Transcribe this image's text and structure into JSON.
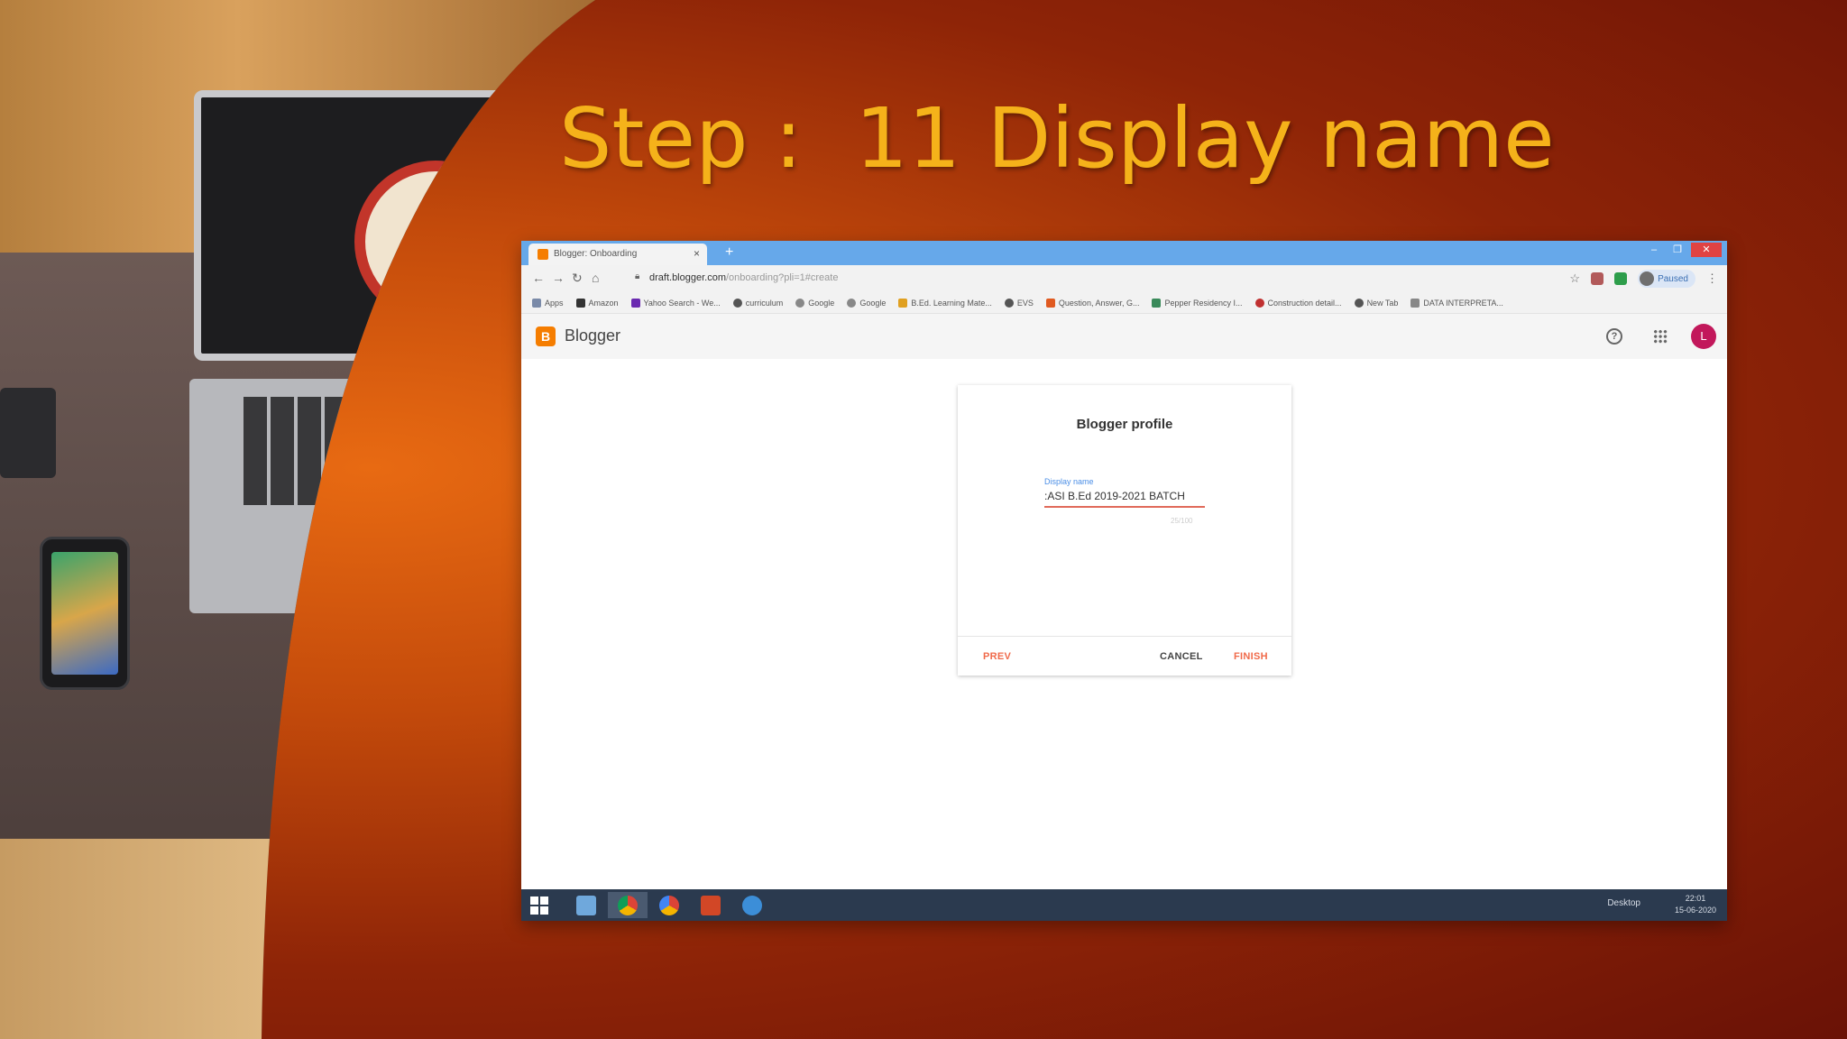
{
  "slide": {
    "title": "Step :  11 Display name"
  },
  "browser": {
    "tab_title": "Blogger: Onboarding",
    "tab_close": "×",
    "new_tab": "+",
    "window_buttons": [
      "–",
      "❐",
      "✕"
    ],
    "url_host": "draft.blogger.com",
    "url_path": "/onboarding?pli=1#create",
    "profile_label": "Paused",
    "bookmarks": [
      "Apps",
      "Amazon",
      "Yahoo Search - We...",
      "curriculum",
      "Google",
      "Google",
      "B.Ed. Learning Mate...",
      "EVS",
      "Question, Answer, G...",
      "Pepper Residency I...",
      "Construction detail...",
      "New Tab",
      "DATA INTERPRETA..."
    ]
  },
  "app": {
    "name": "Blogger",
    "avatar_letter": "L"
  },
  "dialog": {
    "title": "Blogger profile",
    "field_label": "Display name",
    "field_value": ":ASI B.Ed 2019-2021 BATCH",
    "counter": "25/100",
    "prev": "PREV",
    "cancel": "CANCEL",
    "finish": "FINISH"
  },
  "taskbar": {
    "desktop": "Desktop",
    "time": "22:01",
    "date": "15-06-2020"
  },
  "colors": {
    "title_gold": "#f5b21a",
    "accent_orange": "#f06a4a",
    "blogger_orange": "#f57d00",
    "tabbar_blue": "#66a8ea",
    "taskbar": "#2b3a4f"
  }
}
